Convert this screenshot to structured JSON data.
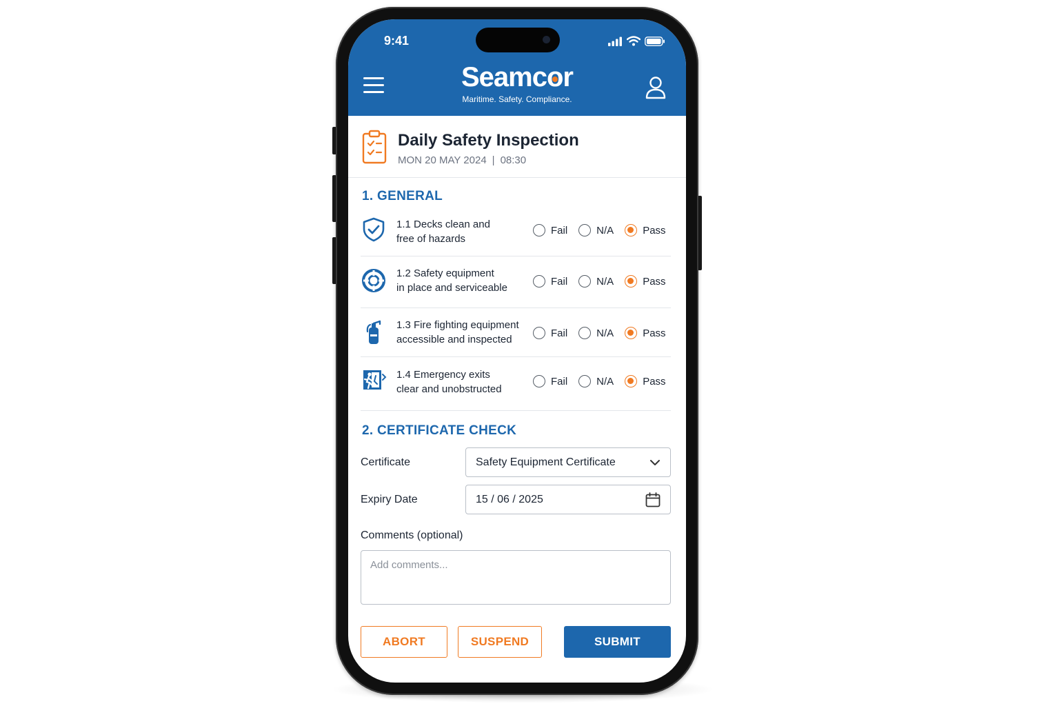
{
  "status_bar": {
    "time": "9:41"
  },
  "header": {
    "brand_pre": "Seamc",
    "brand_o": "o",
    "brand_post": "r",
    "tagline": "Maritime. Safety. Compliance.",
    "accent_color": "#f07a22",
    "primary_color": "#1d67ad"
  },
  "page": {
    "title": "Daily Safety Inspection",
    "date": "MON 20 MAY 2024",
    "separator": "|",
    "time": "08:30"
  },
  "general": {
    "heading": "1. GENERAL",
    "options": [
      "Fail",
      "N/A",
      "Pass"
    ],
    "items": [
      {
        "icon": "shield-check-icon",
        "line1": "1.1 Decks clean and",
        "line2": "free of hazards",
        "selected": "Pass"
      },
      {
        "icon": "lifebuoy-icon",
        "line1": "1.2 Safety equipment",
        "line2": "in place and serviceable",
        "selected": "Pass"
      },
      {
        "icon": "fire-extinguisher-icon",
        "line1": "1.3 Fire fighting equipment",
        "line2": "accessible and inspected",
        "selected": "Pass"
      },
      {
        "icon": "emergency-exit-icon",
        "line1": "1.4 Emergency exits",
        "line2": "clear and unobstructed",
        "selected": "Pass"
      }
    ]
  },
  "certificate": {
    "heading": "2. CERTIFICATE CHECK",
    "certificate_label": "Certificate",
    "certificate_value": "Safety Equipment Certificate",
    "expiry_label": "Expiry Date",
    "expiry_value": "15 / 06 / 2025",
    "comments_label": "Comments (optional)",
    "comments_placeholder": "Add comments..."
  },
  "actions": {
    "abort": "ABORT",
    "suspend": "SUSPEND",
    "submit": "SUBMIT"
  }
}
